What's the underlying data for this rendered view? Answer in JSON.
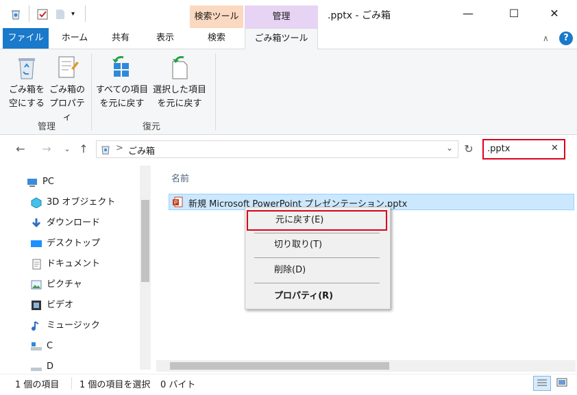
{
  "title_bar": {
    "window_title": ".pptx - ごみ箱",
    "context_tab_search": "検索ツール",
    "context_tab_manage": "管理",
    "minimize_glyph": "—",
    "maximize_glyph": "☐",
    "close_glyph": "✕"
  },
  "ribbon_tabs": {
    "file": "ファイル",
    "home": "ホーム",
    "share": "共有",
    "view": "表示",
    "search": "検索",
    "recycle_tools": "ごみ箱ツール",
    "help_glyph": "?"
  },
  "ribbon": {
    "empty_bin_line1": "ごみ箱を",
    "empty_bin_line2": "空にする",
    "properties_line1": "ごみ箱の",
    "properties_line2": "プロパティ",
    "group_manage": "管理",
    "restore_all_line1": "すべての項目",
    "restore_all_line2": "を元に戻す",
    "restore_selected_line1": "選択した項目",
    "restore_selected_line2": "を元に戻す",
    "group_restore": "復元"
  },
  "address": {
    "path_separator": ">",
    "location": "ごみ箱",
    "search_value": ".pptx"
  },
  "nav_pane": {
    "items": [
      "PC",
      "3D オブジェクト",
      "ダウンロード",
      "デスクトップ",
      "ドキュメント",
      "ピクチャ",
      "ビデオ",
      "ミュージック",
      "C",
      "D"
    ]
  },
  "file_list": {
    "column_name": "名前",
    "rows": [
      {
        "name": "新規 Microsoft PowerPoint プレゼンテーション.pptx"
      }
    ]
  },
  "context_menu": {
    "items": [
      "元に戻す(E)",
      "切り取り(T)",
      "削除(D)",
      "プロパティ(R)"
    ]
  },
  "status_bar": {
    "item_count": "1 個の項目",
    "selected": "1 個の項目を選択",
    "size": "0 バイト"
  },
  "colors": {
    "accent": "#1979ca",
    "highlight_red": "#d9001b",
    "selection": "#cce8ff"
  },
  "icons": [
    "recycle-bin-icon",
    "checkmark-icon",
    "folder-icon",
    "dropdown-icon",
    "properties-icon",
    "restore-icon",
    "back-icon",
    "forward-icon",
    "up-icon",
    "refresh-icon",
    "pc-icon",
    "cube-icon",
    "download-icon",
    "desktop-icon",
    "documents-icon",
    "pictures-icon",
    "videos-icon",
    "music-icon",
    "drive-icon",
    "pptx-icon",
    "details-view-icon",
    "large-icons-view-icon"
  ]
}
